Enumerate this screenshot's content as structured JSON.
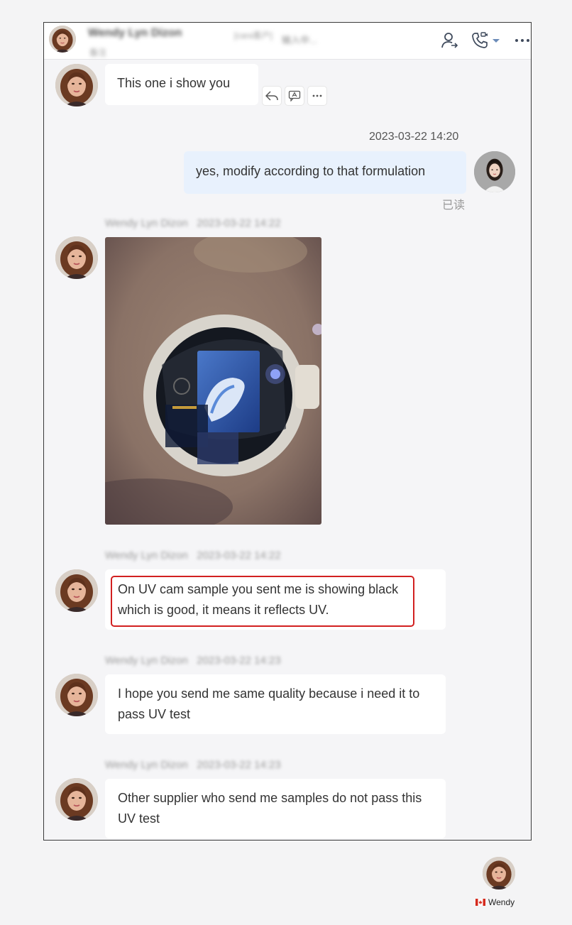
{
  "header": {
    "contact_name": "Wendy Lyn Dizon",
    "contact_tag": "[cara客户]",
    "contact_subtitle": "备注",
    "input_status": "输入中..."
  },
  "messages": [
    {
      "sender": "Wendy Lyn Dizon",
      "text": "This one i show you"
    },
    {
      "sender": "me",
      "time": "2023-03-22 14:20",
      "text": "yes, modify according to that formulation",
      "read_status": "已读"
    },
    {
      "sender": "Wendy Lyn Dizon",
      "time": "2023-03-22 14:22",
      "type": "image"
    },
    {
      "sender": "Wendy Lyn Dizon",
      "time": "2023-03-22 14:22",
      "text": "On UV cam sample you sent me is showing black which is good, it means it reflects UV."
    },
    {
      "sender": "Wendy Lyn Dizon",
      "time": "2023-03-22 14:23",
      "text": "I hope you send me same quality because i need it to pass UV test"
    },
    {
      "sender": "Wendy Lyn Dizon",
      "time": "2023-03-22 14:23",
      "text": "Other supplier who send me samples do not pass this UV test"
    }
  ],
  "footer_user": {
    "name": "Wendy",
    "flag": "canada-flag-icon"
  },
  "colors": {
    "highlight": "#d22020",
    "my_bubble": "#e8f1fd",
    "icon": "#3f4a5c"
  }
}
